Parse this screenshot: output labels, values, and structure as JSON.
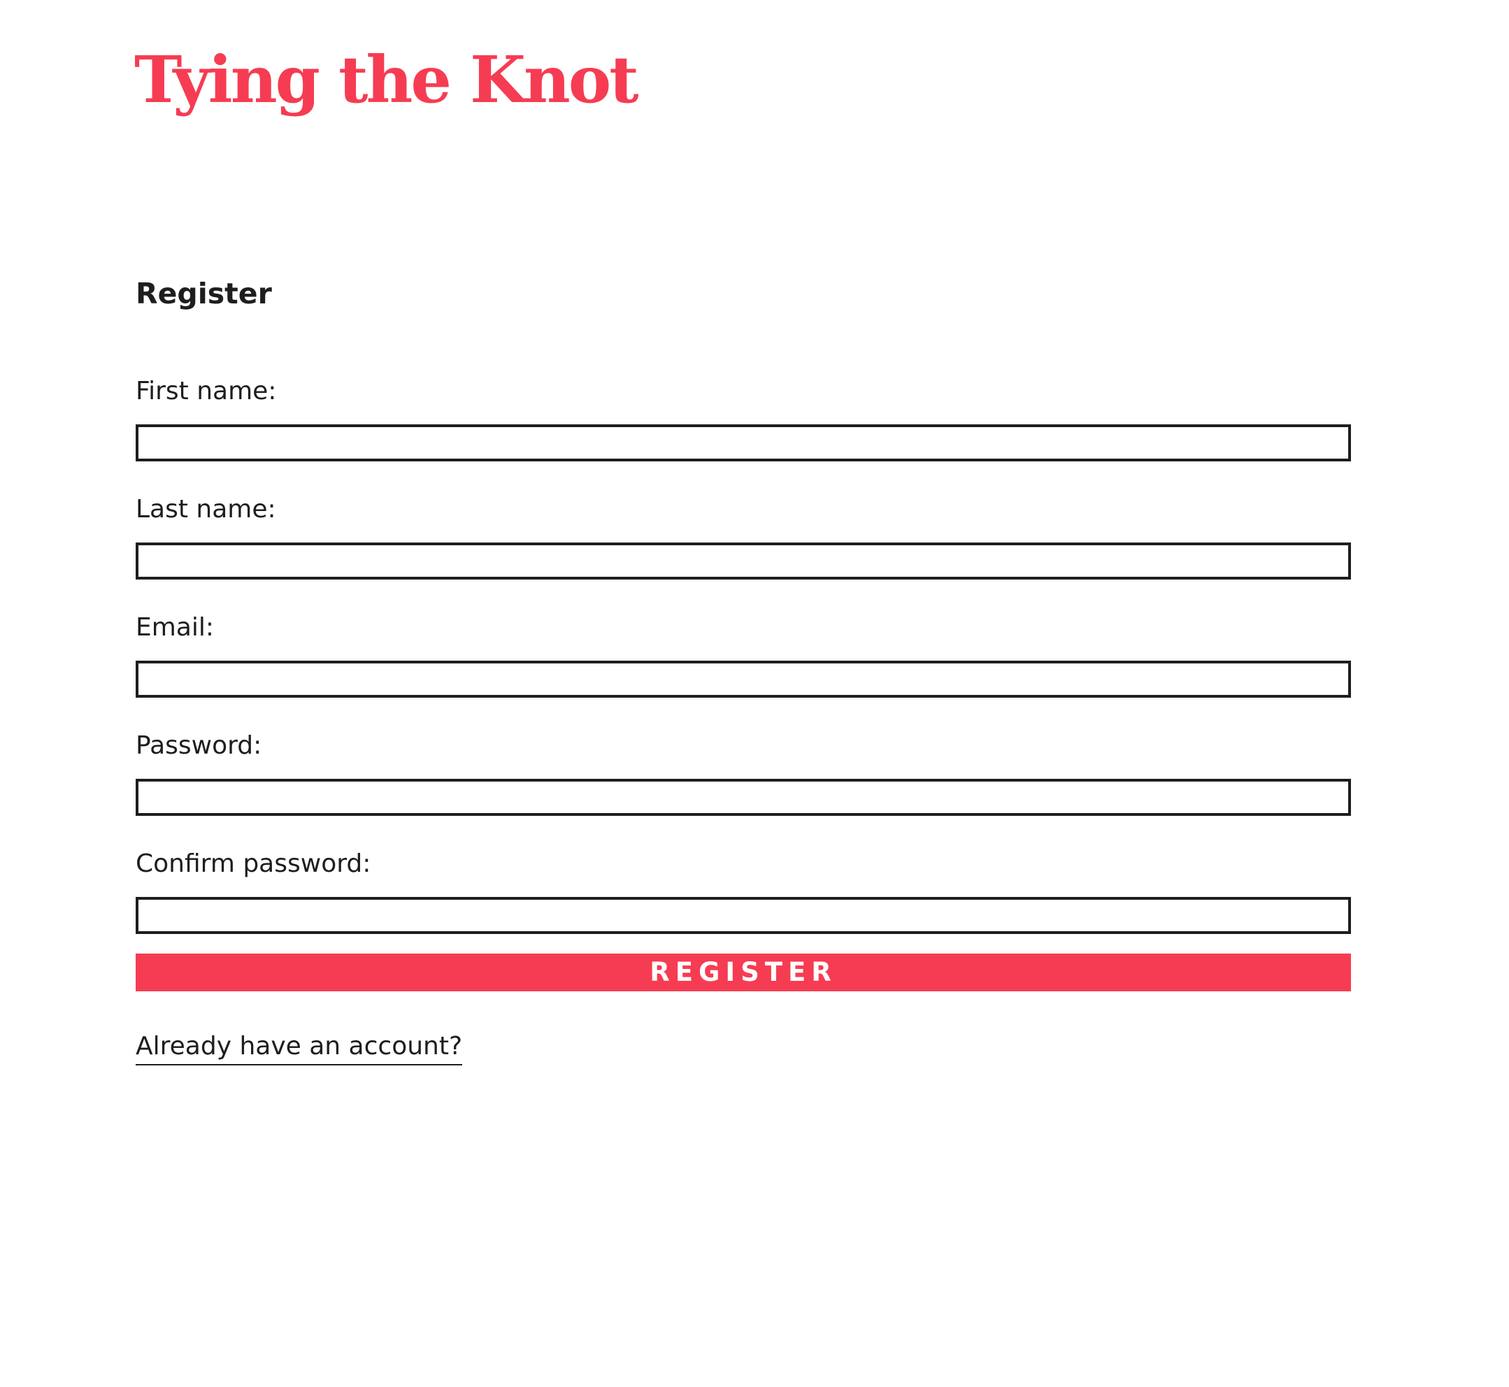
{
  "site": {
    "title": "Tying the Knot"
  },
  "form": {
    "heading": "Register",
    "fields": [
      {
        "label": "First name:",
        "value": ""
      },
      {
        "label": "Last name:",
        "value": ""
      },
      {
        "label": "Email:",
        "value": ""
      },
      {
        "label": "Password:",
        "value": ""
      },
      {
        "label": "Confirm password:",
        "value": ""
      }
    ],
    "submit_label": "Register",
    "login_link": "Already have an account?"
  },
  "colors": {
    "accent": "#f63c52",
    "text": "#1e1e1e",
    "background": "#ffffff"
  }
}
